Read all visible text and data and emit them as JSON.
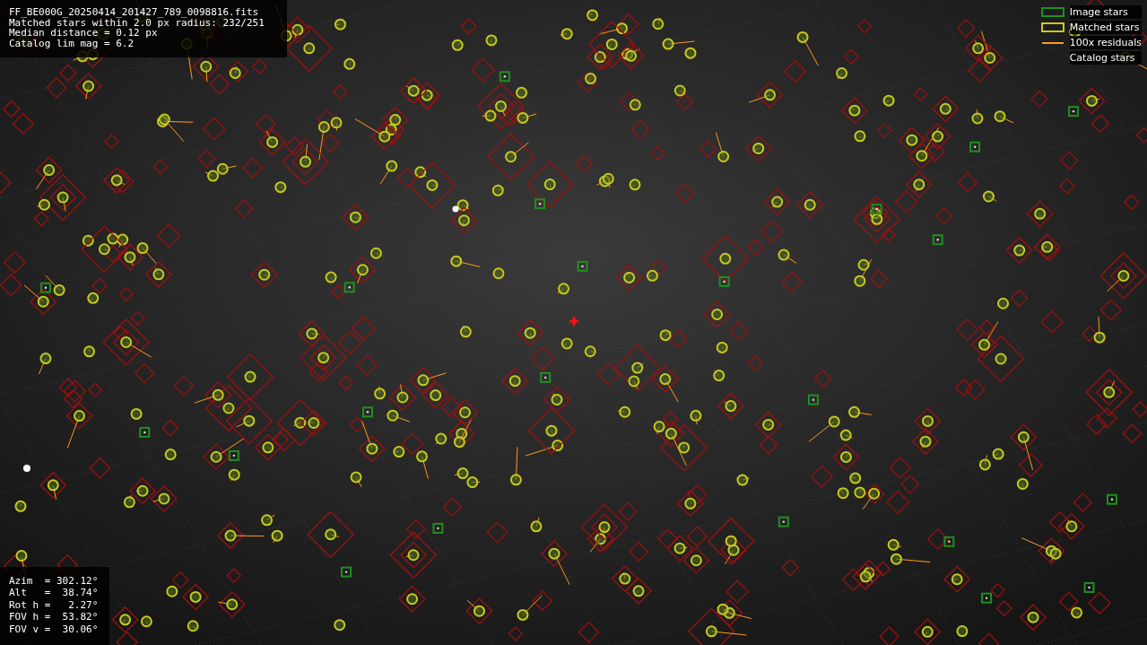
{
  "info": {
    "lines": [
      "FF_BE000G_20250414_201427_789_0098816.fits",
      "Matched stars within 2.0 px radius: 232/251",
      "Median distance = 0.12 px",
      "Catalog lim mag = 6.2"
    ]
  },
  "legend": [
    {
      "kind": "box",
      "label": "Image stars",
      "color": "#1f8f1f"
    },
    {
      "kind": "box",
      "label": "Matched stars",
      "color": "#c8c820"
    },
    {
      "kind": "line",
      "label": "100x residuals",
      "color": "#ff9a1a"
    },
    {
      "kind": "none",
      "label": "Catalog stars"
    }
  ],
  "pointing": {
    "lines": [
      "Azim  = 302.12°",
      "Alt   =  38.74°",
      "Rot h =   2.27°",
      "FOV h =  53.82°",
      "FOV v =  30.06°"
    ]
  }
}
